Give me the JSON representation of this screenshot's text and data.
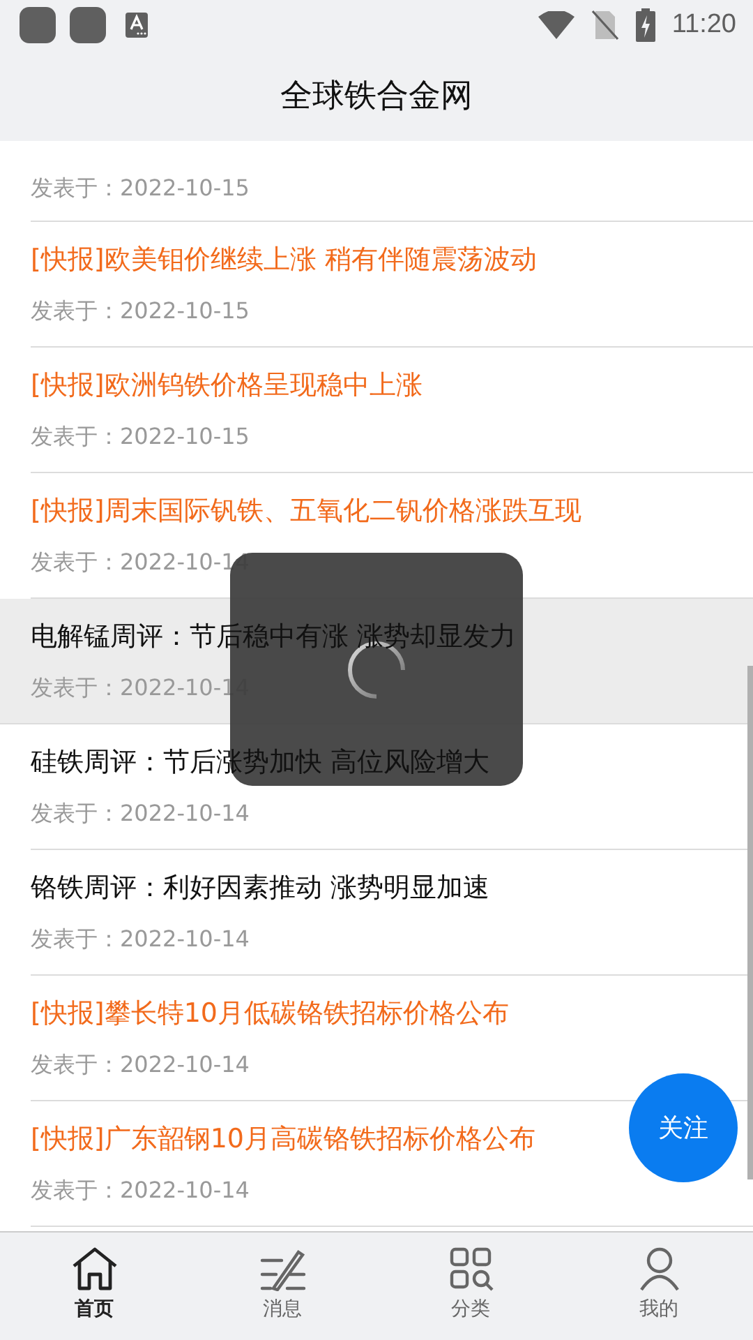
{
  "status_bar": {
    "time": "11:20"
  },
  "header": {
    "title": "全球铁合金网"
  },
  "articles": [
    {
      "kind": "partial",
      "date": "发表于：2022-10-15",
      "selected": false
    },
    {
      "kind": "flash",
      "title": "[快报]欧美钼价继续上涨 稍有伴随震荡波动",
      "date": "发表于：2022-10-15",
      "selected": false
    },
    {
      "kind": "flash",
      "title": "[快报]欧洲钨铁价格呈现稳中上涨",
      "date": "发表于：2022-10-15",
      "selected": false
    },
    {
      "kind": "flash",
      "title": "[快报]周末国际钒铁、五氧化二钒价格涨跌互现",
      "date": "发表于：2022-10-14",
      "selected": false
    },
    {
      "kind": "review",
      "title": "电解锰周评：节后稳中有涨 涨势却显发力",
      "date": "发表于：2022-10-14",
      "selected": true
    },
    {
      "kind": "review",
      "title": "硅铁周评：节后涨势加快 高位风险增大",
      "date": "发表于：2022-10-14",
      "selected": false
    },
    {
      "kind": "review",
      "title": "铬铁周评：利好因素推动 涨势明显加速",
      "date": "发表于：2022-10-14",
      "selected": false
    },
    {
      "kind": "flash",
      "title": "[快报]攀长特10月低碳铬铁招标价格公布",
      "date": "发表于：2022-10-14",
      "selected": false
    },
    {
      "kind": "flash",
      "title": "[快报]广东韶钢10月高碳铬铁招标价格公布",
      "date": "发表于：2022-10-14",
      "selected": false
    }
  ],
  "loading": true,
  "follow_button": "关注",
  "nav": [
    {
      "kind": "home",
      "label": "首页",
      "selected": true
    },
    {
      "kind": "messages",
      "label": "消息",
      "selected": false
    },
    {
      "kind": "categories",
      "label": "分类",
      "selected": false
    },
    {
      "kind": "profile",
      "label": "我的",
      "selected": false
    }
  ]
}
